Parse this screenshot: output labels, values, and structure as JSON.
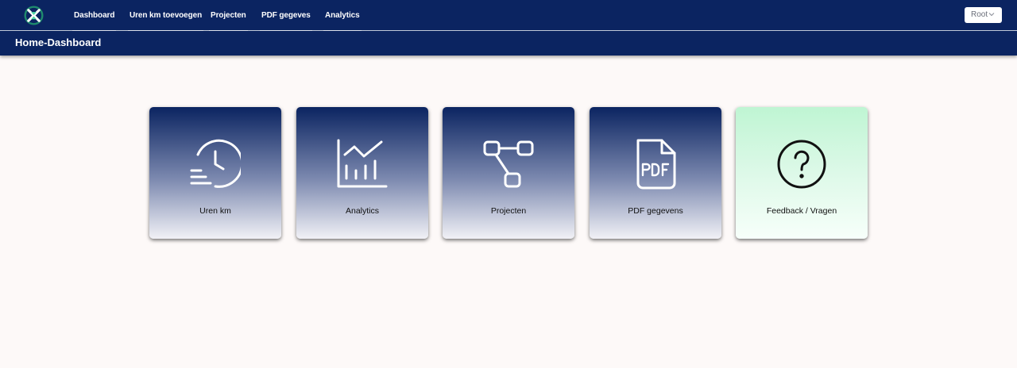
{
  "header": {
    "logo_icon": "hourglass-x-logo-icon",
    "nav": [
      {
        "label": "Dashboard"
      },
      {
        "label": "Uren km toevoegen"
      },
      {
        "label": "Projecten"
      },
      {
        "label": "PDF gegeves"
      },
      {
        "label": "Analytics"
      }
    ],
    "user_select": {
      "value": "Root",
      "icon": "chevron-down-icon"
    }
  },
  "subheader": {
    "title": "Home-Dashboard"
  },
  "tiles": [
    {
      "label": "Uren km",
      "icon": "clock-fast-icon"
    },
    {
      "label": "Analytics",
      "icon": "bar-line-chart-icon"
    },
    {
      "label": "Projecten",
      "icon": "flow-nodes-icon"
    },
    {
      "label": "PDF gegevens",
      "icon": "pdf-file-icon"
    },
    {
      "label": "Feedback / Vragen",
      "icon": "question-circle-icon"
    }
  ],
  "colors": {
    "navy": "#0b2461",
    "background": "#fdf9f8",
    "help_tile": "#bff5d3"
  }
}
